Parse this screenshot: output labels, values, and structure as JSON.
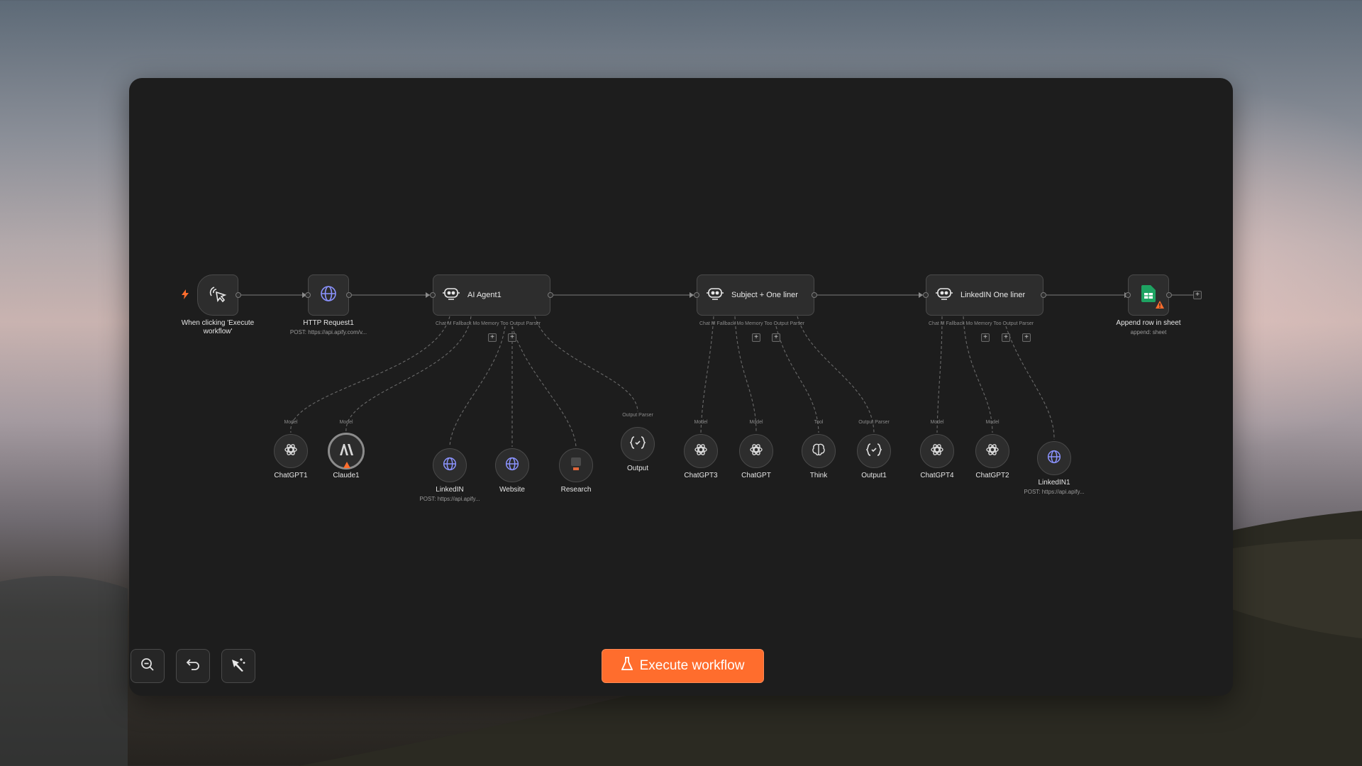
{
  "workflow": {
    "trigger": {
      "label": "When clicking 'Execute workflow'",
      "icon": "cursor-click-icon"
    },
    "http_request": {
      "label": "HTTP Request1",
      "sub": "POST: https://api.apify.com/v..."
    },
    "agents": [
      {
        "title": "AI Agent1",
        "ports": "Chat M Fallback Mo Memory   Too Output Parser"
      },
      {
        "title": "Subject + One liner",
        "ports": "Chat M Fallback Mo Memory   Too Output Parser"
      },
      {
        "title": "LinkedIN One liner",
        "ports": "Chat M Fallback Mo Memory   Too Output Parser"
      }
    ],
    "sheet": {
      "label": "Append row in sheet",
      "sub": "append: sheet"
    },
    "sub_nodes": [
      {
        "label": "ChatGPT1",
        "conn": "Model"
      },
      {
        "label": "Claude1",
        "conn": "Model"
      },
      {
        "label": "LinkedIN",
        "sub": "POST: https://api.apify..."
      },
      {
        "label": "Website"
      },
      {
        "label": "Research"
      },
      {
        "label": "Output",
        "conn": "Output Parser"
      },
      {
        "label": "ChatGPT3",
        "conn": "Model"
      },
      {
        "label": "ChatGPT",
        "conn": "Model"
      },
      {
        "label": "Think",
        "conn": "Tool"
      },
      {
        "label": "Output1",
        "conn": "Output Parser"
      },
      {
        "label": "ChatGPT4",
        "conn": "Model"
      },
      {
        "label": "ChatGPT2",
        "conn": "Model"
      },
      {
        "label": "LinkedIN1",
        "sub": "POST: https://api.apify..."
      }
    ]
  },
  "toolbar": {
    "execute_label": "Execute workflow",
    "zoom_out": "zoom-out-icon",
    "undo": "undo-icon",
    "tidy": "wand-icon"
  },
  "colors": {
    "accent": "#ff6d2d",
    "canvas": "#1d1d1d",
    "node": "#2d2d2d",
    "globe": "#8b93ff",
    "sheets": "#1ea362"
  }
}
